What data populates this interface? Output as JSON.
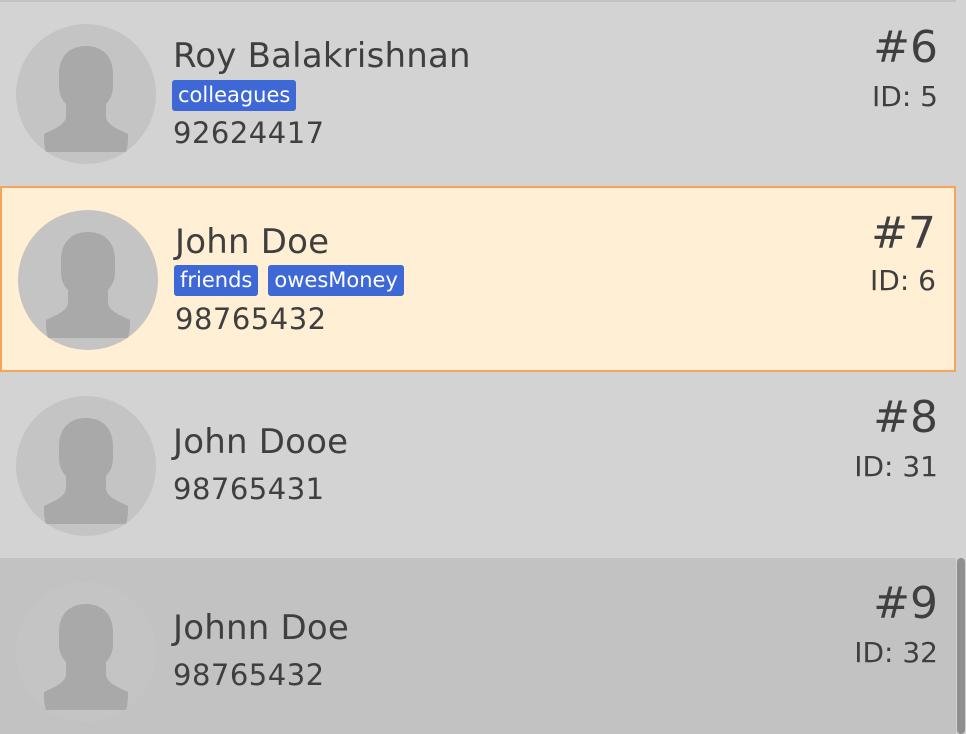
{
  "persons": [
    {
      "name": "Roy Balakrishnan",
      "tags": [
        "colleagues"
      ],
      "phone": "92624417",
      "index": "#6",
      "id_label": "ID: 5",
      "selected": false,
      "avatar_icon": "person-silhouette-icon"
    },
    {
      "name": "John Doe",
      "tags": [
        "friends",
        "owesMoney"
      ],
      "phone": "98765432",
      "index": "#7",
      "id_label": "ID: 6",
      "selected": true,
      "avatar_icon": "person-silhouette-icon"
    },
    {
      "name": "John Dooe",
      "tags": [],
      "phone": "98765431",
      "index": "#8",
      "id_label": "ID: 31",
      "selected": false,
      "avatar_icon": "person-silhouette-icon"
    },
    {
      "name": "Johnn Doe",
      "tags": [],
      "phone": "98765432",
      "index": "#9",
      "id_label": "ID: 32",
      "selected": false,
      "avatar_icon": "person-silhouette-icon"
    }
  ],
  "colors": {
    "tag_background": "#3e68d6",
    "selected_background": "#feefd5",
    "selected_border": "#f5a55b",
    "card_background": "#d3d3d3",
    "hover_background": "#c2c2c2"
  }
}
